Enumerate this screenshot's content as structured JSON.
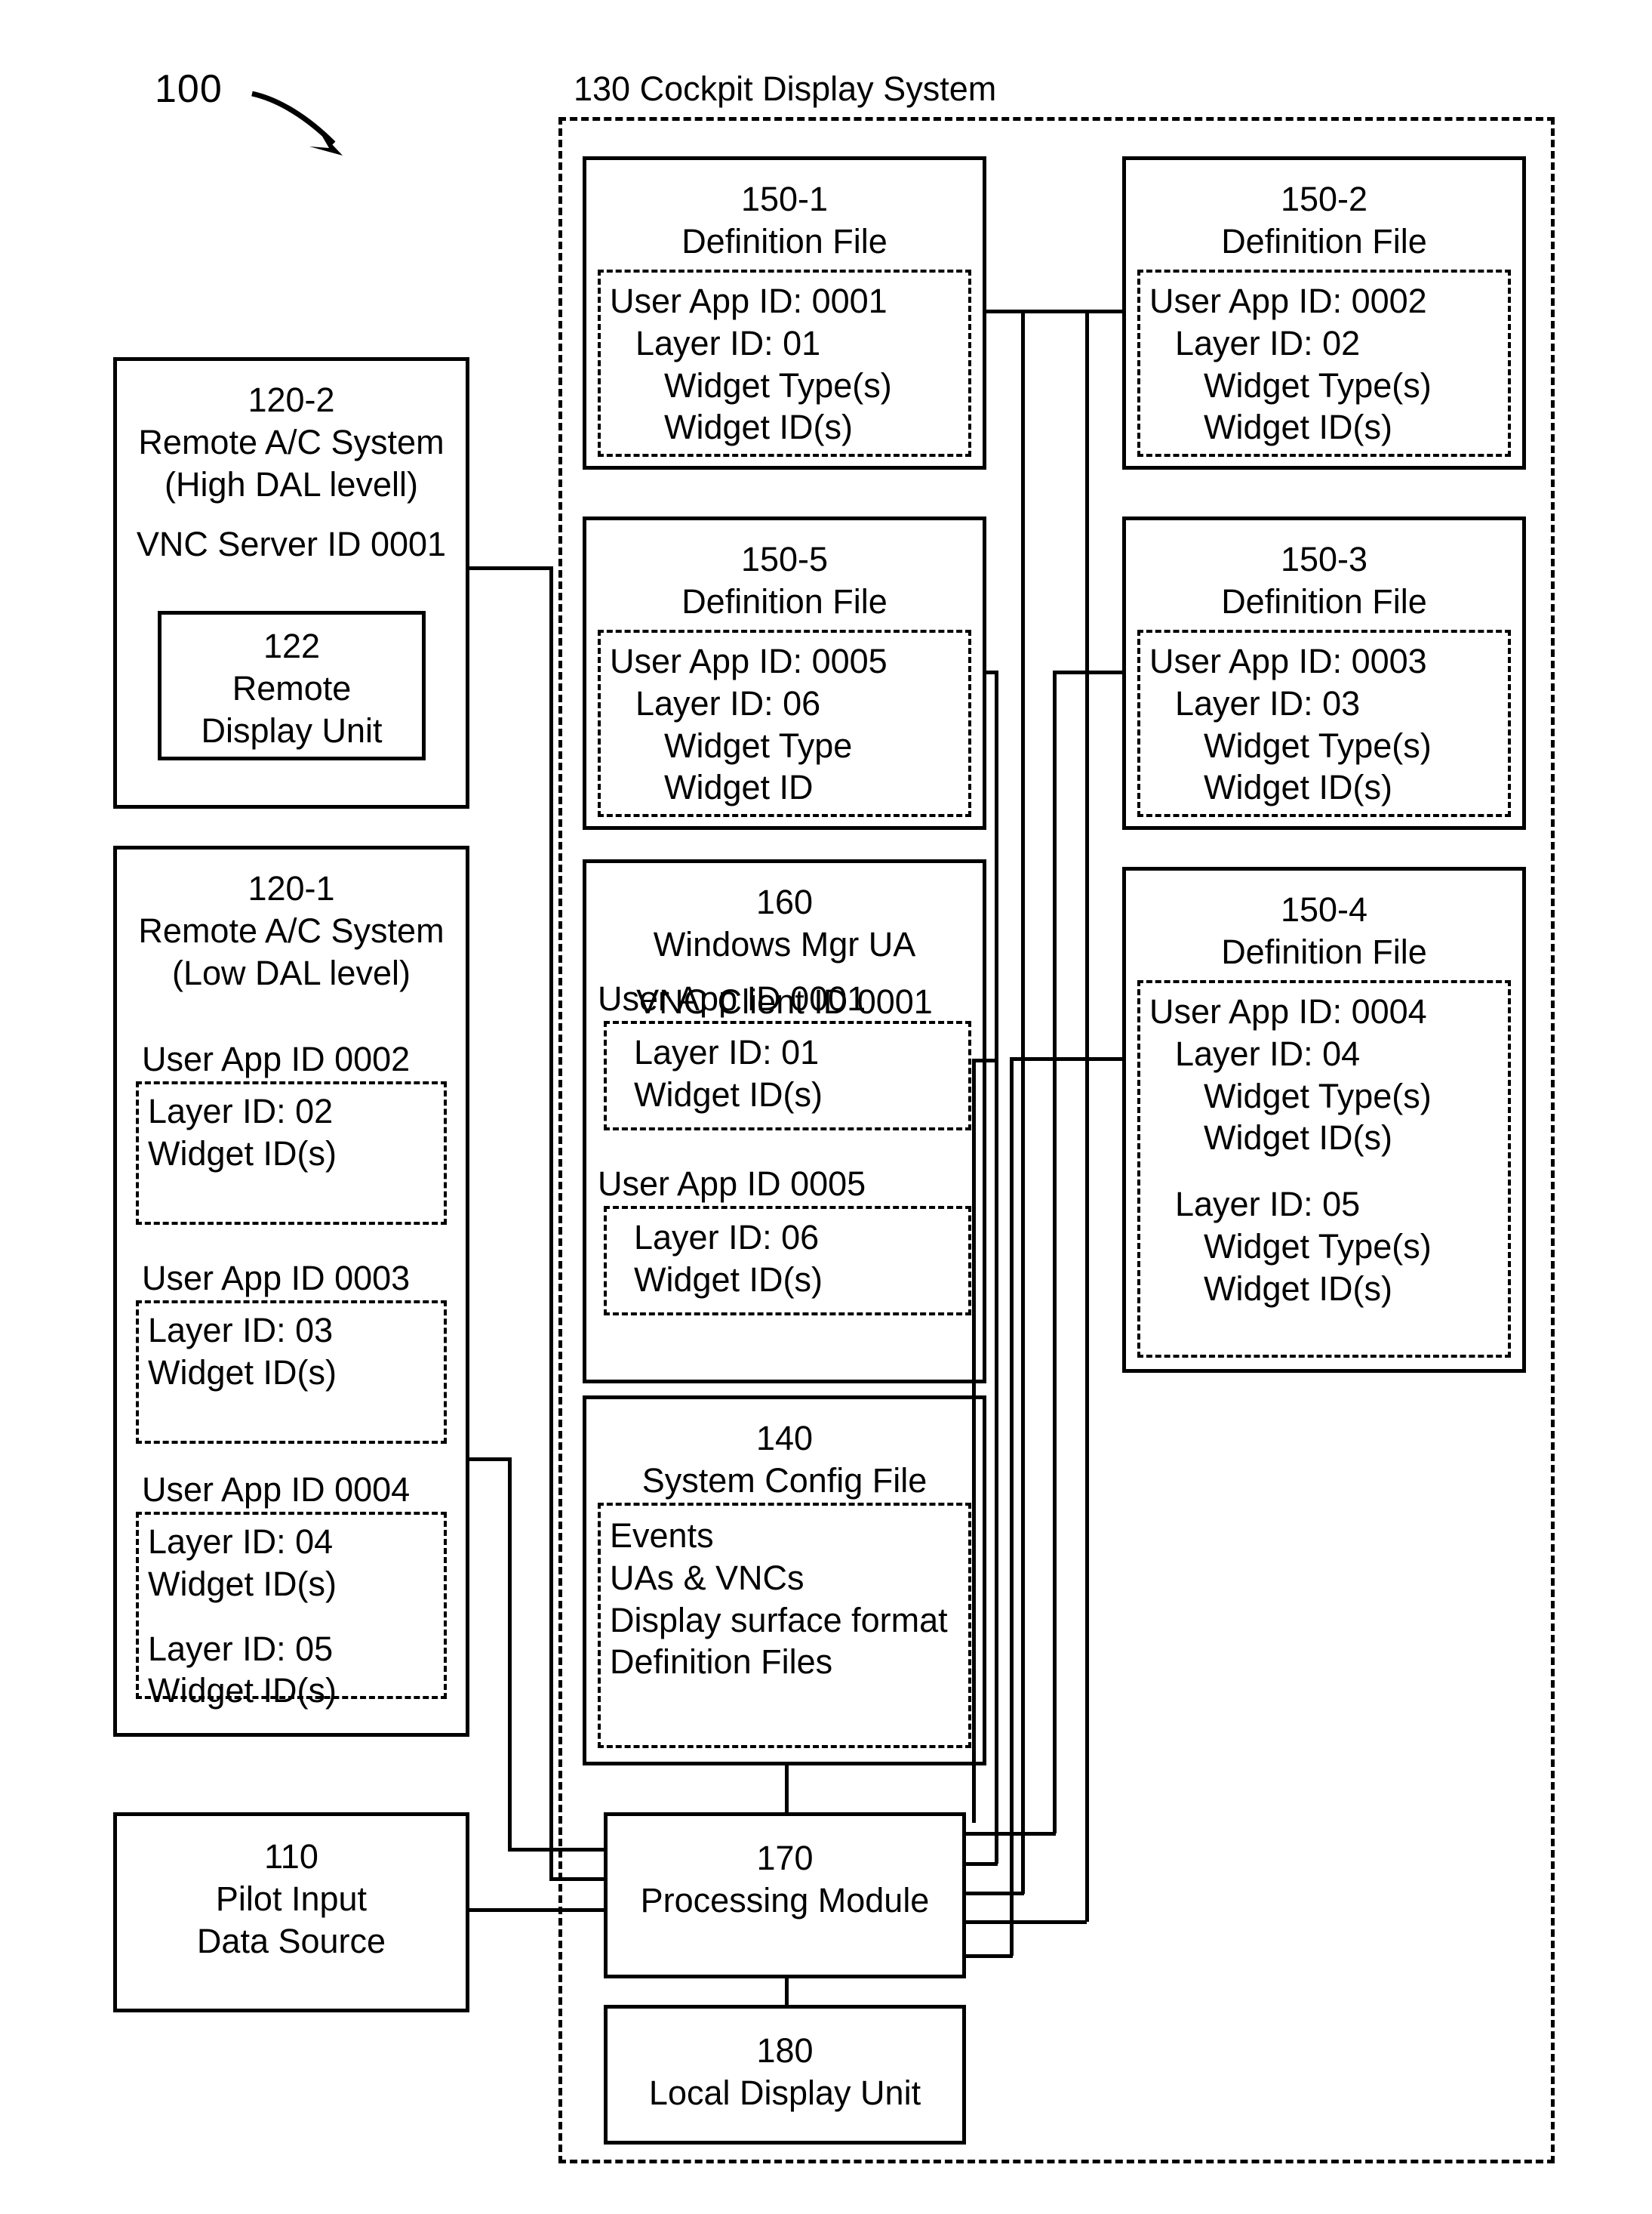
{
  "figure": {
    "number": "100",
    "system_label": "130 Cockpit Display System"
  },
  "boxes": {
    "def_150_1": {
      "id": "150-1",
      "title": "Definition File",
      "lines": [
        "User App ID: 0001",
        "Layer ID: 01",
        "Widget Type(s)",
        "Widget ID(s)"
      ]
    },
    "def_150_2": {
      "id": "150-2",
      "title": "Definition File",
      "lines": [
        "User App ID: 0002",
        "Layer ID: 02",
        "Widget Type(s)",
        "Widget ID(s)"
      ]
    },
    "def_150_5": {
      "id": "150-5",
      "title": "Definition File",
      "lines": [
        "User App ID: 0005",
        "Layer ID: 06",
        "Widget Type",
        "Widget ID"
      ]
    },
    "def_150_3": {
      "id": "150-3",
      "title": "Definition File",
      "lines": [
        "User App ID: 0003",
        "Layer ID: 03",
        "Widget Type(s)",
        "Widget ID(s)"
      ]
    },
    "def_150_4": {
      "id": "150-4",
      "title": "Definition File",
      "lines": [
        "User App ID: 0004",
        "Layer ID: 04",
        "Widget Type(s)",
        "Widget ID(s)",
        "Layer ID: 05",
        "Widget Type(s)",
        "Widget ID(s)"
      ]
    },
    "win_mgr_160": {
      "id": "160",
      "title": "Windows Mgr UA",
      "vnc": "VNC Client ID 0001",
      "app_a": {
        "header": "User App ID 0001",
        "lines": [
          "Layer ID: 01",
          "Widget ID(s)"
        ]
      },
      "app_b": {
        "header": "User App ID 0005",
        "lines": [
          "Layer ID: 06",
          "Widget ID(s)"
        ]
      }
    },
    "sys_config_140": {
      "id": "140",
      "title": "System Config File",
      "lines": [
        "Events",
        "UAs & VNCs",
        "Display surface format",
        "Definition Files"
      ]
    },
    "remote_120_2": {
      "id": "120-2",
      "title": "Remote A/C System",
      "dal": "(High DAL levell)",
      "vnc": "VNC Server ID 0001",
      "inner": {
        "id": "122",
        "line1": "Remote",
        "line2": "Display Unit"
      }
    },
    "remote_120_1": {
      "id": "120-1",
      "title": "Remote A/C System",
      "dal": "(Low DAL level)",
      "apps": [
        {
          "header": "User App ID 0002",
          "lines": [
            "Layer ID: 02",
            "Widget ID(s)"
          ]
        },
        {
          "header": "User App ID 0003",
          "lines": [
            "Layer ID: 03",
            "Widget ID(s)"
          ]
        },
        {
          "header": "User App ID 0004",
          "lines": [
            "Layer ID: 04",
            "Widget ID(s)",
            "",
            "Layer ID: 05",
            "Widget ID(s)"
          ]
        }
      ]
    },
    "pilot_110": {
      "id": "110",
      "line1": "Pilot Input",
      "line2": "Data Source"
    },
    "processing_170": {
      "id": "170",
      "title": "Processing Module"
    },
    "local_display_180": {
      "id": "180",
      "title": "Local Display Unit"
    }
  }
}
